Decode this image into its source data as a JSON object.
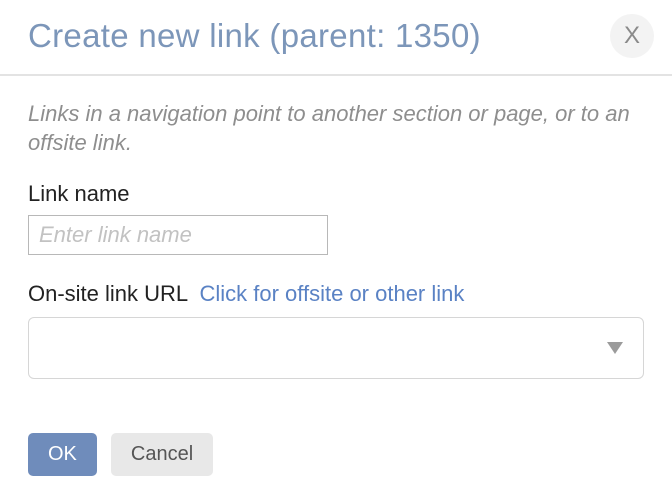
{
  "dialog": {
    "title": "Create new link (parent: 1350)",
    "close_label": "X",
    "description": "Links in a navigation point to another section or page, or to an offsite link.",
    "link_name": {
      "label": "Link name",
      "placeholder": "Enter link name",
      "value": ""
    },
    "url": {
      "label": "On-site link URL",
      "offsite_link_text": "Click for offsite or other link",
      "selected": ""
    },
    "buttons": {
      "ok": "OK",
      "cancel": "Cancel"
    }
  }
}
